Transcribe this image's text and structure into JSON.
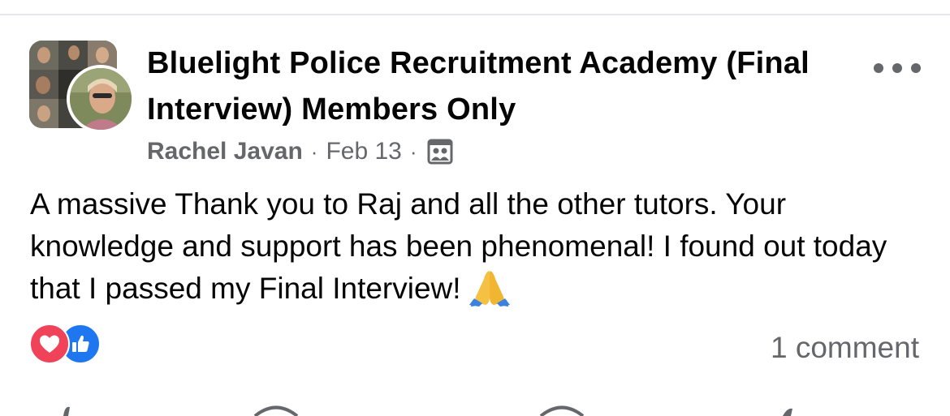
{
  "post": {
    "group_name": "Bluelight Police Recruitment Academy (Final Interview) Members Only",
    "author": "Rachel Javan",
    "separator": "·",
    "date": "Feb 13",
    "audience_icon": "members-only-icon",
    "body_text": "A massive Thank you to Raj and all the other tutors. Your knowledge and support has been phenomenal! I found out today that I passed my Final Interview!",
    "emoji": "folded-hands-emoji",
    "reactions": [
      "love-reaction-icon",
      "like-reaction-icon"
    ],
    "comment_count": "1 comment",
    "more_icon": "more-options-icon"
  },
  "colors": {
    "text_primary": "#050505",
    "text_secondary": "#65676b",
    "love": "#f0435a",
    "like": "#1e77f0",
    "divider": "#e4e6eb"
  }
}
